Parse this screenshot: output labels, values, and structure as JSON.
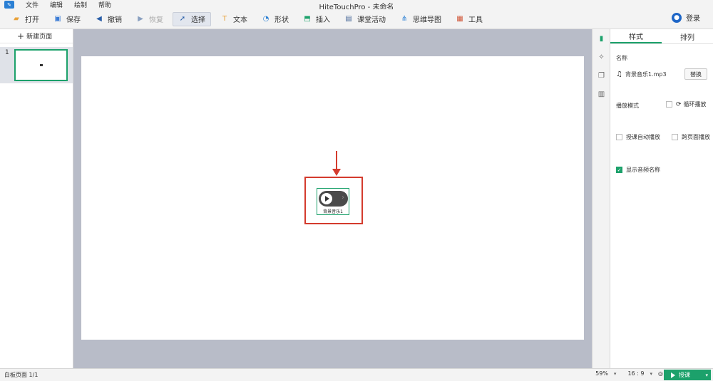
{
  "window": {
    "title": "HiteTouchPro - 未命名"
  },
  "menu": [
    "文件",
    "编辑",
    "绘制",
    "帮助"
  ],
  "toolbar": [
    {
      "label": "打开",
      "icon": "folder-open-icon",
      "color": "#e8a23a",
      "state": "normal"
    },
    {
      "label": "保存",
      "icon": "save-icon",
      "color": "#3a7bd5",
      "state": "normal"
    },
    {
      "label": "撤销",
      "icon": "undo-icon",
      "color": "#2a5fa8",
      "state": "normal"
    },
    {
      "label": "恢复",
      "icon": "redo-icon",
      "color": "#8aa0c0",
      "state": "disabled"
    },
    {
      "label": "选择",
      "icon": "cursor-icon",
      "color": "#2a5fa8",
      "state": "active"
    },
    {
      "label": "文本",
      "icon": "text-icon",
      "color": "#e8a23a",
      "state": "normal"
    },
    {
      "label": "形状",
      "icon": "shape-icon",
      "color": "#2a7fd4",
      "state": "normal"
    },
    {
      "label": "插入",
      "icon": "insert-icon",
      "color": "#1ca16b",
      "state": "normal"
    },
    {
      "label": "课堂活动",
      "icon": "activity-icon",
      "color": "#4a6a9a",
      "state": "normal"
    },
    {
      "label": "思维导图",
      "icon": "mindmap-icon",
      "color": "#2a7fd4",
      "state": "normal"
    },
    {
      "label": "工具",
      "icon": "toolbox-icon",
      "color": "#d0583a",
      "state": "normal"
    }
  ],
  "login_label": "登录",
  "left_panel": {
    "new_page_label": "新建页面",
    "pages": [
      {
        "number": "1"
      }
    ]
  },
  "canvas": {
    "audio_caption": "背景音乐1"
  },
  "right_panel": {
    "tabs": [
      {
        "label": "样式",
        "active": true
      },
      {
        "label": "排列",
        "active": false
      }
    ],
    "name_label": "名称",
    "file_name": "背景音乐1.mp3",
    "replace_label": "替换",
    "play_mode_label": "播放模式",
    "loop_label": "循环播放",
    "auto_play_label": "授课自动播放",
    "cross_page_label": "跨页面播放",
    "show_name_label": "显示音频名称",
    "show_name_checked": true
  },
  "status": {
    "page_info": "白板页面 1/1",
    "zoom": "59%",
    "ratio": "16 : 9",
    "lecture_label": "授课"
  }
}
